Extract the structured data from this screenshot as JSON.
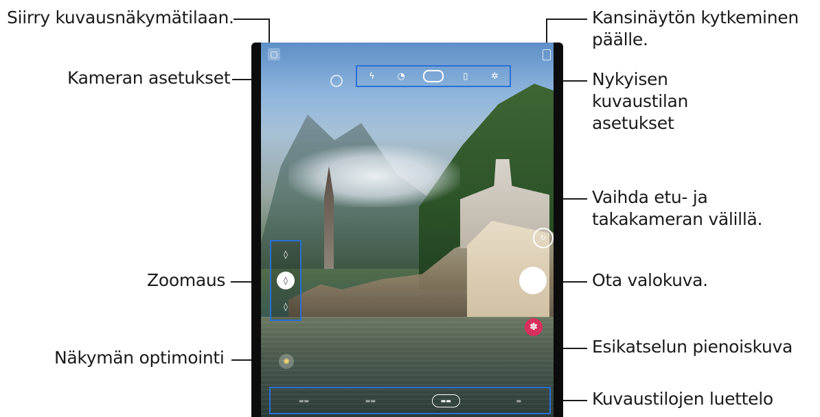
{
  "callouts": {
    "view_mode": "Siirry kuvausnäkymätilaan.",
    "camera_settings": "Kameran asetukset",
    "zoom": "Zoomaus",
    "optimizer": "Näkymän optimointi",
    "cover_screen": "Kansinäytön kytkeminen päälle.",
    "current_mode_settings": "Nykyisen kuvaustilan asetukset",
    "switch_camera": "Vaihda etu- ja takakameran välillä.",
    "take_photo": "Ota valokuva.",
    "preview_thumbnail": "Esikatselun pienoiskuva",
    "mode_list": "Kuvaustilojen luettelo"
  },
  "top_toolbar": {
    "icons": [
      "flash-icon",
      "timer-icon",
      "ratio-icon",
      "motion-photo-icon",
      "filter-icon"
    ]
  },
  "zoom": {
    "levels": [
      "ultra-wide-icon",
      "wide-icon",
      "tele-icon"
    ],
    "active_index": 1
  },
  "icons": {
    "view_mode": "view-mode-icon",
    "settings": "gear-icon",
    "cover_screen": "cover-screen-icon",
    "optimizer": "scene-optimizer-icon",
    "switch": "switch-camera-icon",
    "thumb": "flower-icon"
  },
  "colors": {
    "accent_box": "#2a6fd6",
    "thumbnail": "#d7305c"
  }
}
